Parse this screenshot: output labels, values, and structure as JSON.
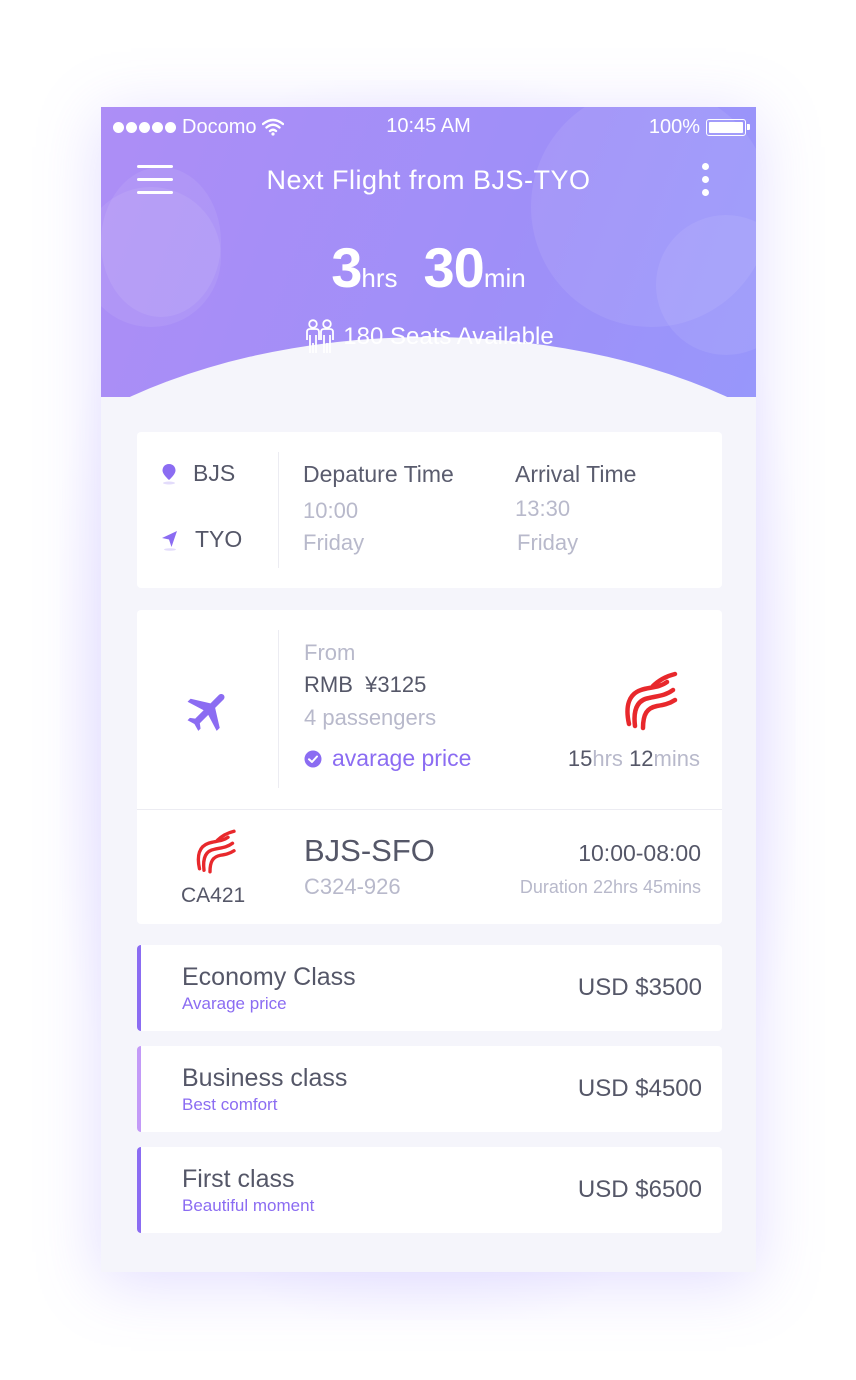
{
  "status_bar": {
    "carrier": "Docomo",
    "time": "10:45 AM",
    "battery": "100%"
  },
  "header": {
    "title": "Next Flight from BJS-TYO",
    "hours_value": "3",
    "hours_unit": "hrs",
    "minutes_value": "30",
    "minutes_unit": "min",
    "seats_text": "180 Seats Available"
  },
  "route": {
    "origin": "BJS",
    "destination": "TYO",
    "departure_label": "Depature Time",
    "departure_time": "10:00",
    "departure_day": "Friday",
    "arrival_label": "Arrival Time",
    "arrival_time": "13:30",
    "arrival_day": "Friday"
  },
  "fare": {
    "from_label": "From",
    "currency": "RMB",
    "amount": "¥3125",
    "passengers": "4 passengers",
    "badge": "avarage price",
    "dur_hours": "15",
    "dur_hours_unit": "hrs",
    "dur_mins": "12",
    "dur_mins_unit": "mins"
  },
  "flight": {
    "number": "CA421",
    "route": "BJS-SFO",
    "code": "C324-926",
    "time_range": "10:00-08:00",
    "duration": "Duration 22hrs 45mins"
  },
  "classes": [
    {
      "name": "Economy Class",
      "subtitle": "Avarage price",
      "price": "USD $3500",
      "accent": "#8b6cf2"
    },
    {
      "name": "Business class",
      "subtitle": "Best comfort",
      "price": "USD $4500",
      "accent": "#c39af7"
    },
    {
      "name": "First class",
      "subtitle": "Beautiful moment",
      "price": "USD $6500",
      "accent": "#8b6cf2"
    }
  ],
  "colors": {
    "accent": "#8b6cf2",
    "header_start": "#ad8ef6",
    "header_end": "#9897fb",
    "airline_red": "#e8282c"
  }
}
